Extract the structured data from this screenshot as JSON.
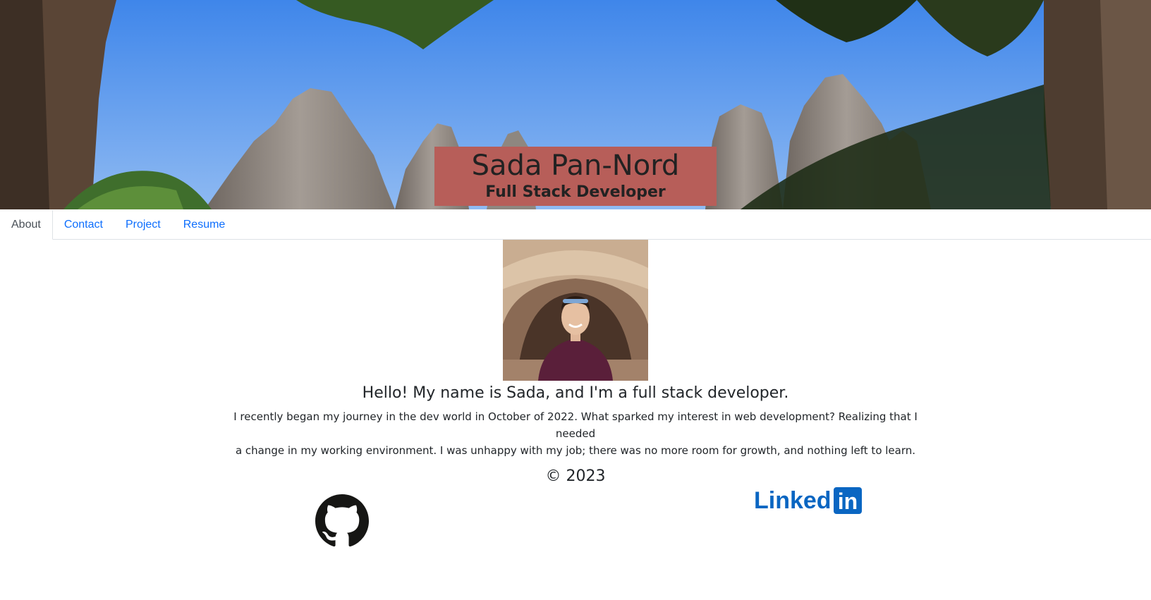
{
  "header": {
    "name": "Sada Pan-Nord",
    "role": "Full Stack Developer",
    "title_box_color": "#b75e59"
  },
  "nav": {
    "tabs": [
      {
        "label": "About",
        "active": true
      },
      {
        "label": "Contact",
        "active": false
      },
      {
        "label": "Project",
        "active": false
      },
      {
        "label": "Resume",
        "active": false
      }
    ],
    "link_color": "#0d6efd"
  },
  "about": {
    "heading": "Hello! My name is Sada, and I'm a full stack developer.",
    "body_line_1": "I recently began my journey in the dev world in October of 2022. What sparked my interest in web development? Realizing that I needed",
    "body_line_2": "a change in my working environment. I was unhappy with my job; there was no more room for growth, and nothing left to learn."
  },
  "footer": {
    "copyright": "© 2023",
    "social": [
      {
        "icon": "github-icon"
      },
      {
        "icon": "linkedin-icon",
        "text": "Linked",
        "badge": "in",
        "color": "#0a66c2"
      }
    ]
  }
}
